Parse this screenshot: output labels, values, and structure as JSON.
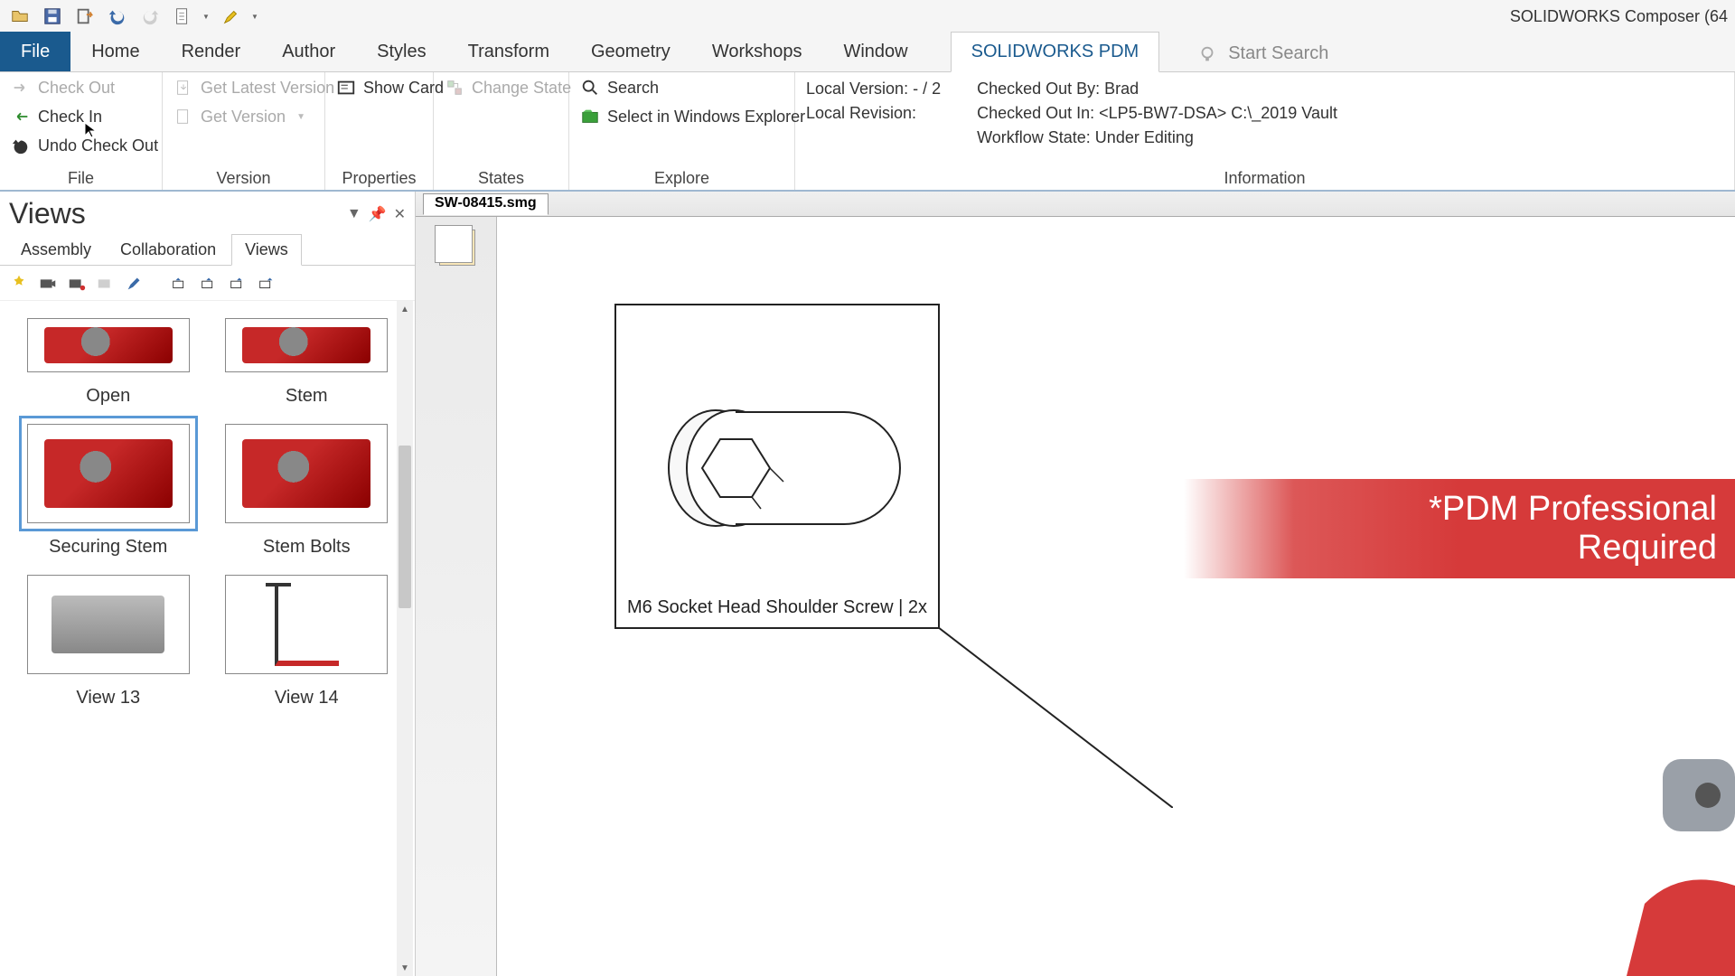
{
  "app_title": "SOLIDWORKS Composer (64",
  "qat_icons": [
    "open",
    "save",
    "export",
    "undo",
    "redo",
    "page",
    "brush"
  ],
  "tabs": {
    "file": "File",
    "items": [
      "Home",
      "Render",
      "Author",
      "Styles",
      "Transform",
      "Geometry",
      "Workshops",
      "Window"
    ],
    "pdm": "SOLIDWORKS PDM",
    "search_placeholder": "Start Search"
  },
  "ribbon": {
    "file": {
      "check_out": "Check Out",
      "check_in": "Check In",
      "undo_check_out": "Undo Check Out",
      "label": "File"
    },
    "version": {
      "get_latest": "Get Latest Version",
      "get_version": "Get Version",
      "label": "Version"
    },
    "properties": {
      "show_card": "Show Card",
      "label": "Properties"
    },
    "states": {
      "change_state": "Change State",
      "label": "States"
    },
    "explore": {
      "search": "Search",
      "select_explorer": "Select in Windows Explorer",
      "label": "Explore"
    },
    "info": {
      "local_version": "Local Version:  - / 2",
      "local_revision": "Local Revision:",
      "checked_out_by": "Checked Out By:  Brad",
      "checked_out_in": "Checked Out In:  <LP5-BW7-DSA>  C:\\_2019 Vault",
      "workflow_state": "Workflow State:  Under Editing",
      "label": "Information"
    }
  },
  "views_panel": {
    "title": "Views",
    "tabs": {
      "assembly": "Assembly",
      "collaboration": "Collaboration",
      "views": "Views"
    },
    "thumbs": {
      "open": "Open",
      "stem": "Stem",
      "securing_stem": "Securing Stem",
      "stem_bolts": "Stem Bolts",
      "view13": "View 13",
      "view14": "View 14"
    }
  },
  "document_tab": "SW-08415.smg",
  "callout": {
    "label": "M6 Socket Head Shoulder Screw | 2x"
  },
  "overlay": {
    "line1": "*PDM Professional",
    "line2": "Required"
  }
}
